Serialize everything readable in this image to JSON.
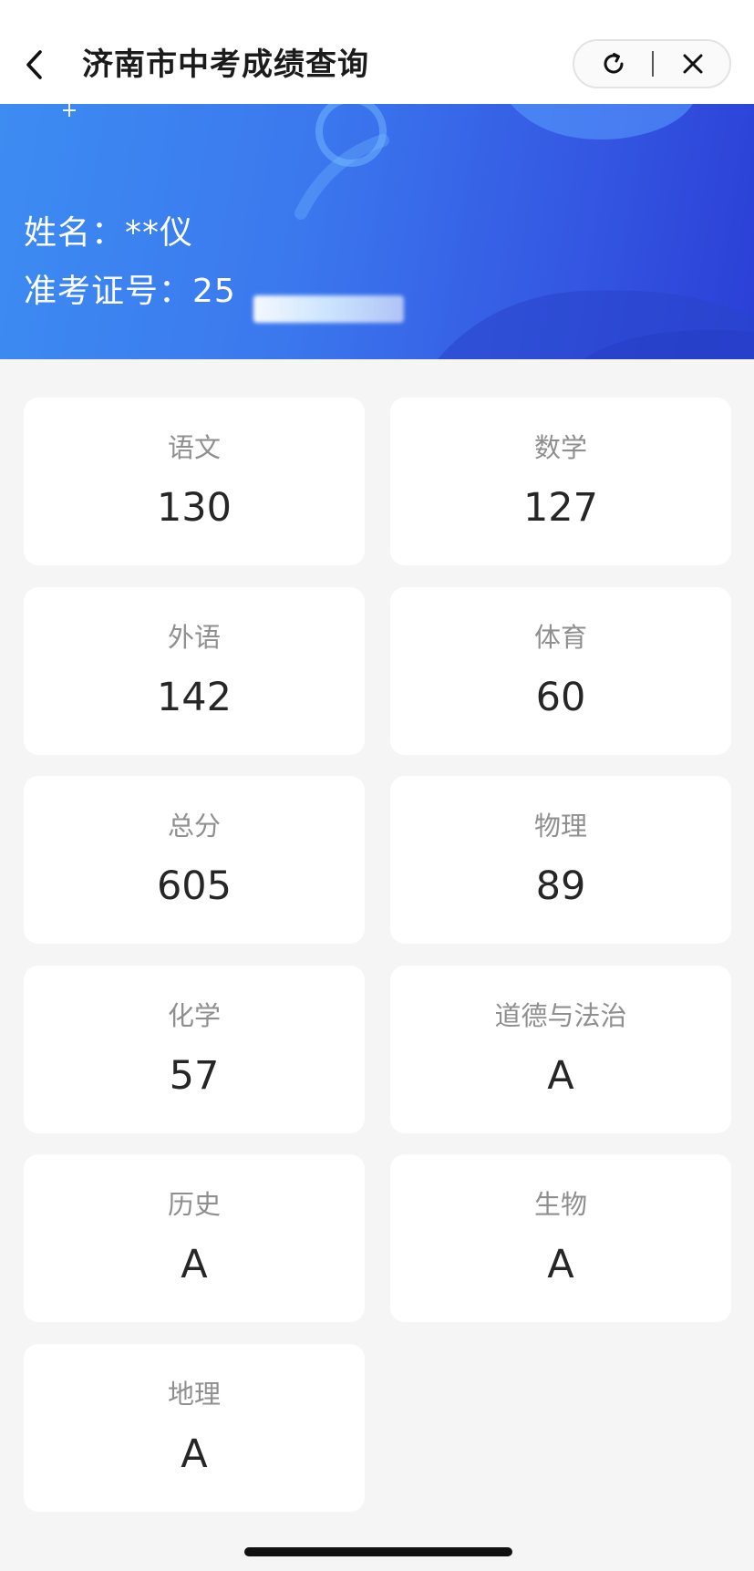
{
  "header": {
    "title": "济南市中考成绩查询",
    "back_icon": "chevron-left-icon",
    "refresh_icon": "refresh-icon",
    "close_icon": "close-icon"
  },
  "banner": {
    "name_label": "姓名：",
    "name_value": "**仪",
    "ticket_label": "准考证号：",
    "ticket_value": "25",
    "colors": {
      "start": "#3d8cf2",
      "end": "#2b3fd6"
    }
  },
  "scores": [
    {
      "subject": "语文",
      "score": "130"
    },
    {
      "subject": "数学",
      "score": "127"
    },
    {
      "subject": "外语",
      "score": "142"
    },
    {
      "subject": "体育",
      "score": "60"
    },
    {
      "subject": "总分",
      "score": "605"
    },
    {
      "subject": "物理",
      "score": "89"
    },
    {
      "subject": "化学",
      "score": "57"
    },
    {
      "subject": "道德与法治",
      "score": "A"
    },
    {
      "subject": "历史",
      "score": "A"
    },
    {
      "subject": "生物",
      "score": "A"
    },
    {
      "subject": "地理",
      "score": "A"
    }
  ]
}
